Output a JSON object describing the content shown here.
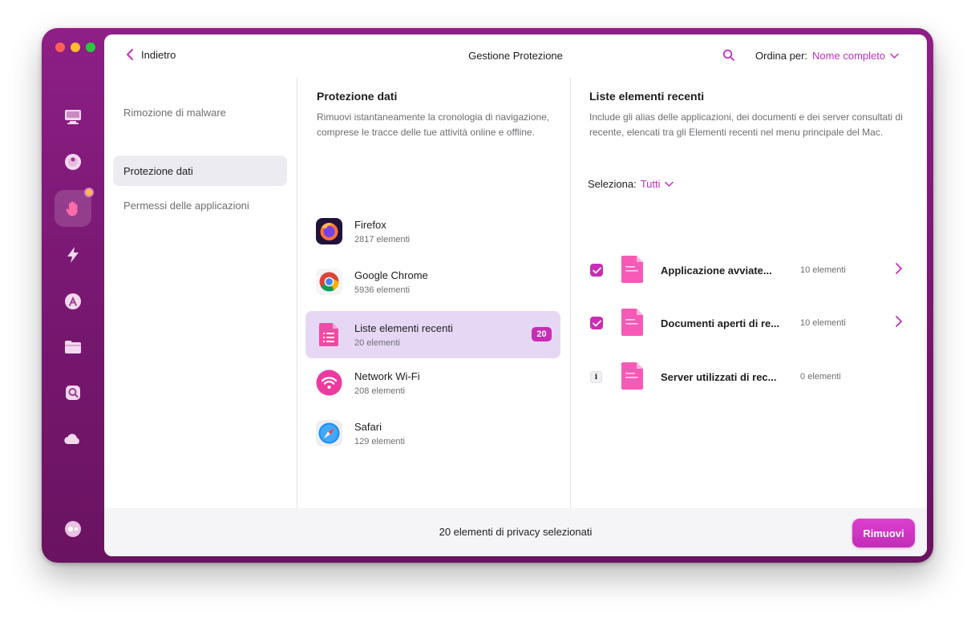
{
  "window": {
    "title": "Gestione Protezione"
  },
  "topbar": {
    "back_label": "Indietro",
    "title": "Gestione Protezione",
    "sort_label": "Ordina per:",
    "sort_value": "Nome completo"
  },
  "sidebar_icons": [
    "monitor-icon",
    "disk-icon",
    "hand-protection-icon",
    "lightning-icon",
    "app-store-icon",
    "folder-icon",
    "cleanup-icon",
    "cloud-icon",
    "assistant-icon"
  ],
  "left_nav": {
    "items": [
      {
        "label": "Rimozione di malware",
        "active": false
      },
      {
        "label": "Protezione dati",
        "active": true
      },
      {
        "label": "Permessi delle applicazioni",
        "active": false
      }
    ]
  },
  "middle": {
    "title": "Protezione dati",
    "description": "Rimuovi istantaneamente la cronologia di navigazione, comprese le tracce delle tue attività online e offline.",
    "apps": [
      {
        "name": "Firefox",
        "count": "2817 elementi",
        "icon": "firefox-icon",
        "selected": false,
        "badge": ""
      },
      {
        "name": "Google Chrome",
        "count": "5936 elementi",
        "icon": "chrome-icon",
        "selected": false,
        "badge": ""
      },
      {
        "name": "Liste elementi recenti",
        "count": "20 elementi",
        "icon": "recent-items-icon",
        "selected": true,
        "badge": "20"
      },
      {
        "name": "Network Wi-Fi",
        "count": "208 elementi",
        "icon": "wifi-icon",
        "selected": false,
        "badge": ""
      },
      {
        "name": "Safari",
        "count": "129 elementi",
        "icon": "safari-icon",
        "selected": false,
        "badge": ""
      }
    ]
  },
  "right": {
    "title": "Liste elementi recenti",
    "description": "Include gli alias delle applicazioni, dei documenti e dei server consultati di recente, elencati tra gli Elementi recenti nel menu principale del Mac.",
    "select_label": "Seleziona:",
    "select_value": "Tutti",
    "items": [
      {
        "name": "Applicazione avviate...",
        "count": "10 elementi",
        "checked": true,
        "expandable": true
      },
      {
        "name": "Documenti aperti di re...",
        "count": "10 elementi",
        "checked": true,
        "expandable": true
      },
      {
        "name": "Server utilizzati di rec...",
        "count": "0 elementi",
        "checked": false,
        "expandable": false,
        "info_glyph": "i"
      }
    ]
  },
  "footer": {
    "summary": "20 elementi di privacy selezionati",
    "remove_label": "Rimuovi"
  },
  "colors": {
    "accent": "#c72db5",
    "sidebar_bg": "#7a1873",
    "selected_row": "#e6d8f4",
    "active_nav": "#ecebf1"
  }
}
